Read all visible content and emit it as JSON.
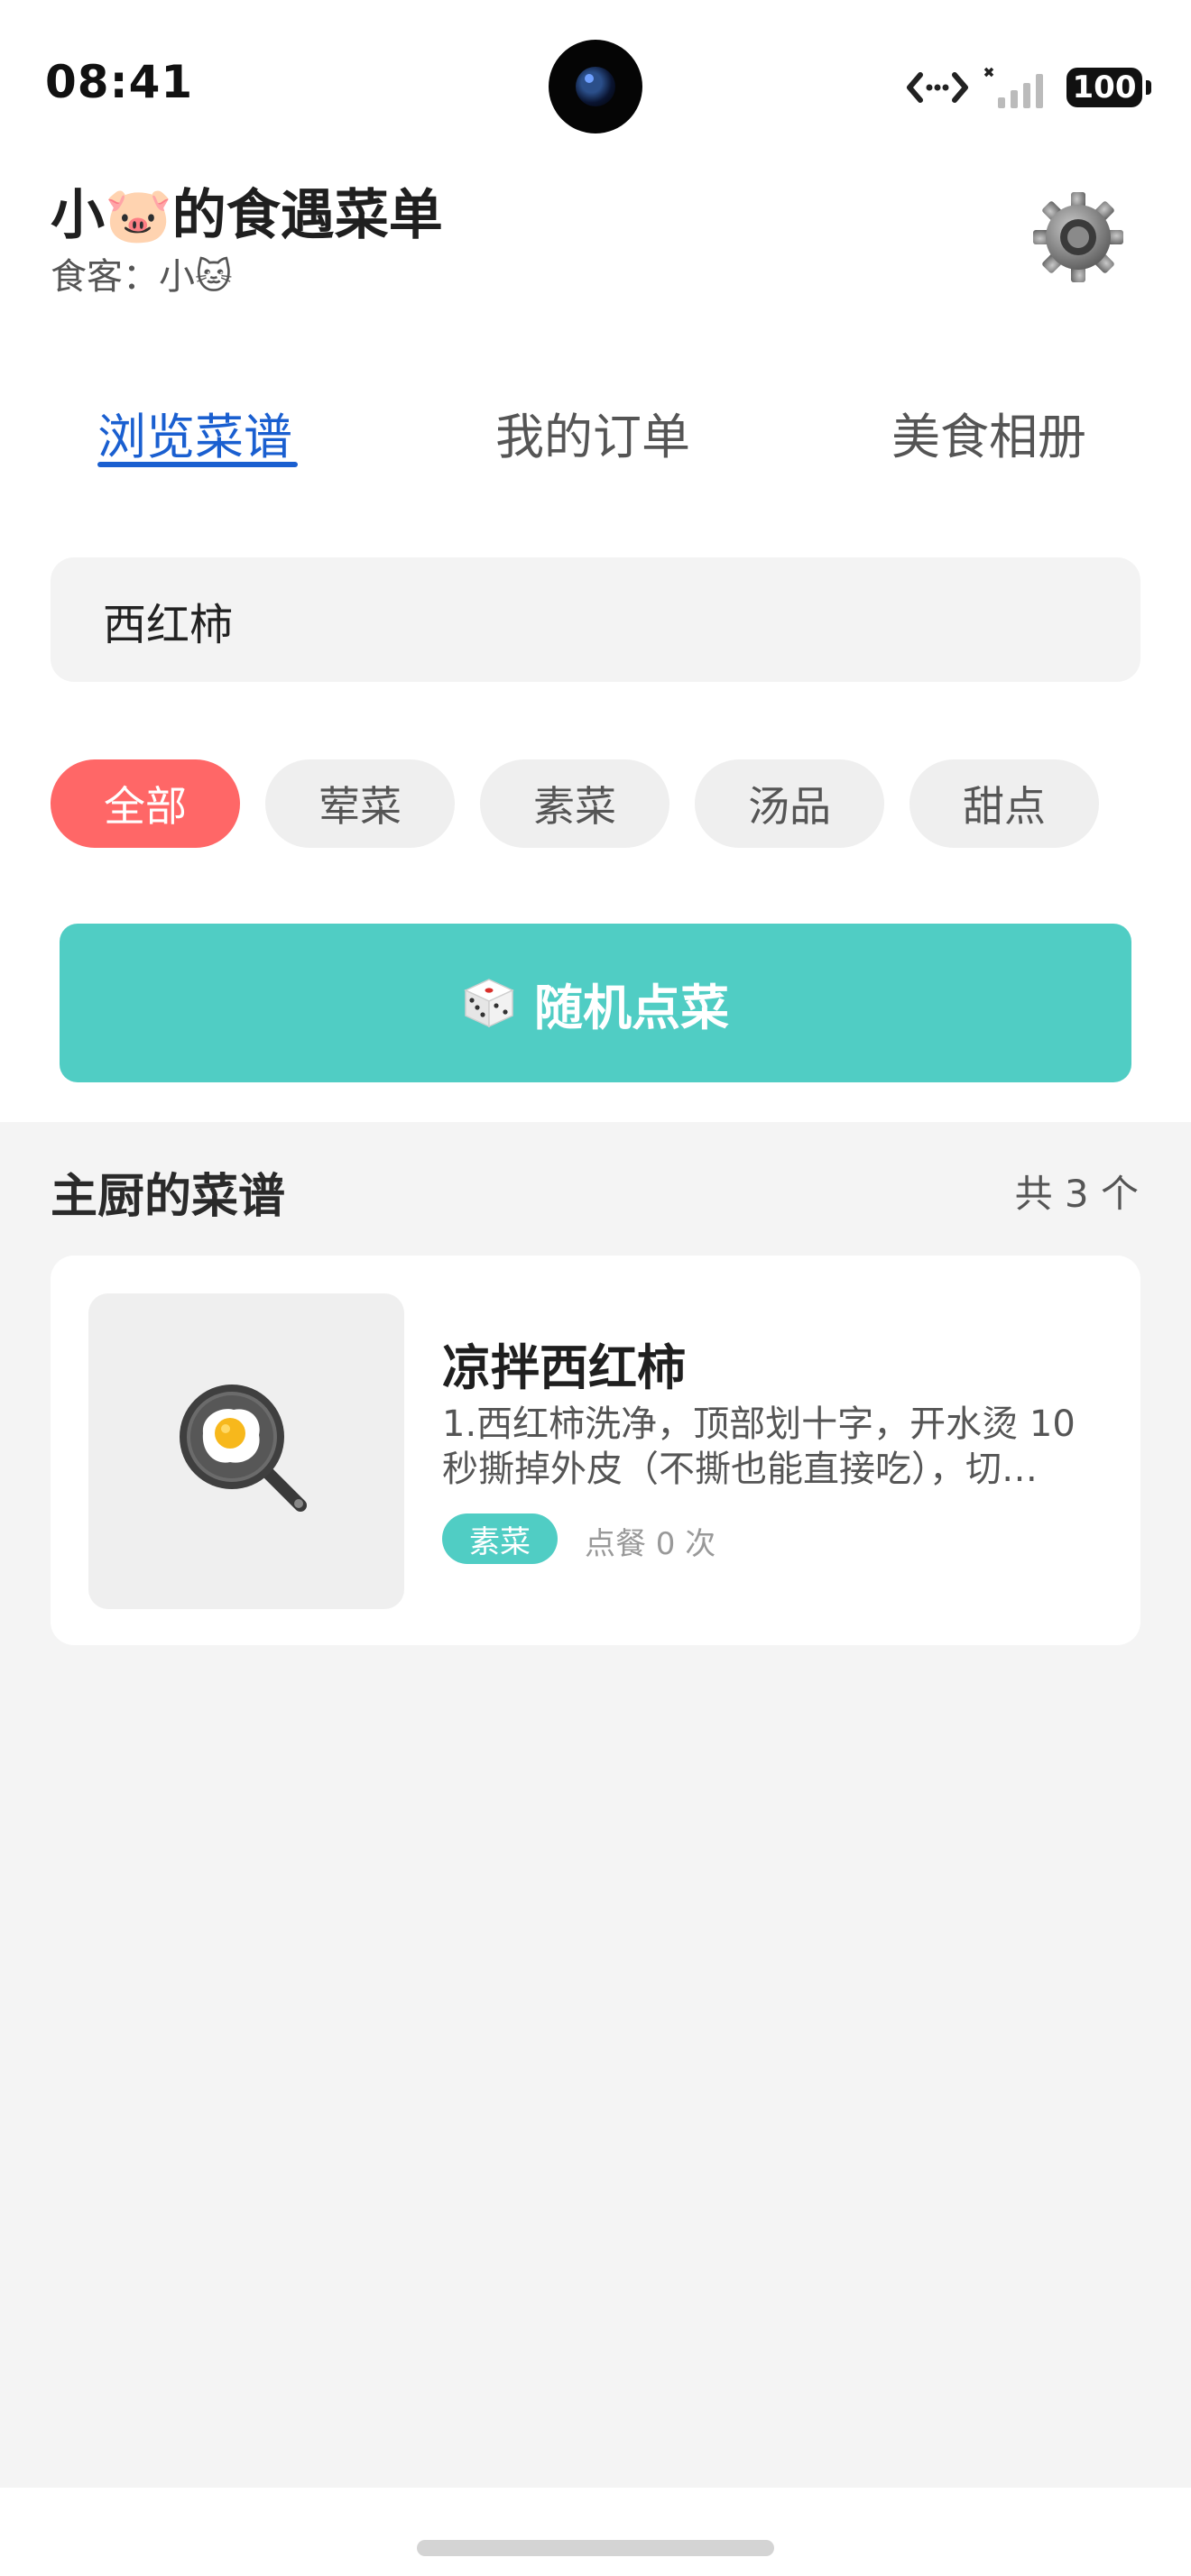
{
  "status_bar": {
    "time": "08:41",
    "battery": "100",
    "icons": [
      "camera-icon",
      "data-transfer-icon",
      "cellular-signal-icon",
      "battery-icon"
    ]
  },
  "header": {
    "title": "小🐷的食遇菜单",
    "subtitle": "食客：小🐱",
    "settings_icon": "gear-icon"
  },
  "tabs": [
    {
      "label": "浏览菜谱",
      "active": true
    },
    {
      "label": "我的订单",
      "active": false
    },
    {
      "label": "美食相册",
      "active": false
    }
  ],
  "search": {
    "value": "西红柿",
    "placeholder": ""
  },
  "categories": [
    {
      "label": "全部",
      "active": true
    },
    {
      "label": "荤菜",
      "active": false
    },
    {
      "label": "素菜",
      "active": false
    },
    {
      "label": "汤品",
      "active": false
    },
    {
      "label": "甜点",
      "active": false
    }
  ],
  "random_button": {
    "label": "随机点菜",
    "icon": "dice-icon"
  },
  "section": {
    "title": "主厨的菜谱",
    "count": "共 3 个"
  },
  "recipes": [
    {
      "title": "凉拌西红柿",
      "description": "1.西红柿洗净，顶部划十字，开水烫 10 秒撕掉外皮（不撕也能直接吃），切…",
      "tag": "素菜",
      "orders": "点餐 0 次",
      "image_icon": "frying-pan-egg-icon"
    }
  ],
  "colors": {
    "accent_blue": "#1a5fd0",
    "chip_active": "#ff6767",
    "teal": "#50cdc4",
    "content_bg": "#f4f4f4"
  }
}
